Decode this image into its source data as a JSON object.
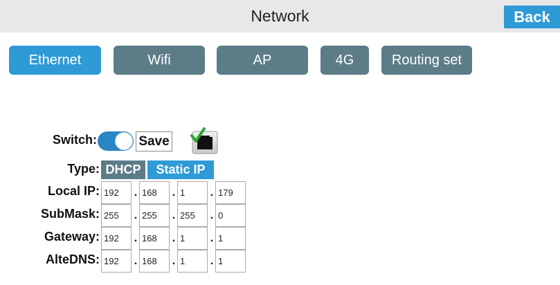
{
  "header": {
    "title": "Network",
    "back_label": "Back"
  },
  "tabs": [
    {
      "label": "Ethernet",
      "active": true
    },
    {
      "label": "Wifi",
      "active": false
    },
    {
      "label": "AP",
      "active": false
    },
    {
      "label": "4G",
      "active": false
    },
    {
      "label": "Routing set",
      "active": false
    }
  ],
  "form": {
    "switch_label": "Switch:",
    "switch_on": true,
    "save_label": "Save",
    "status_icon": "network-connected-icon",
    "type_label": "Type:",
    "type_options": [
      "DHCP",
      "Static IP"
    ],
    "type_selected": "Static IP",
    "separator": ".",
    "rows": [
      {
        "label": "Local IP:",
        "octets": [
          "192",
          "168",
          "1",
          "179"
        ]
      },
      {
        "label": "SubMask:",
        "octets": [
          "255",
          "255",
          "255",
          "0"
        ]
      },
      {
        "label": "Gateway:",
        "octets": [
          "192",
          "168",
          "1",
          "1"
        ]
      },
      {
        "label": "AlteDNS:",
        "octets": [
          "192",
          "168",
          "1",
          "1"
        ]
      }
    ]
  },
  "colors": {
    "accent": "#2e9ad6",
    "tab_inactive": "#5c7c88",
    "header_bg": "#e8e8e8",
    "toggle_on": "#2a85c4"
  }
}
